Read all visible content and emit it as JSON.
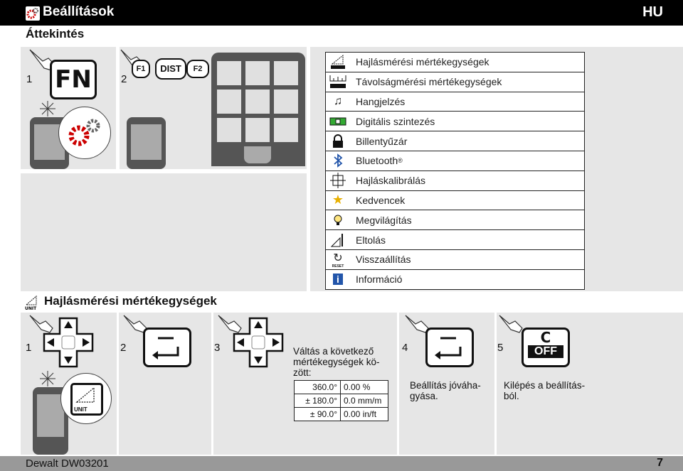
{
  "header": {
    "title": "Beállítások",
    "lang": "HU"
  },
  "subtitle": "Áttekintés",
  "overview": {
    "step1": "1",
    "step2": "2",
    "key_fn": "FN",
    "key_f1": "F1",
    "key_dist": "DIST",
    "key_f2": "F2"
  },
  "menu": [
    {
      "label": "Hajlásmérési mértékegységek",
      "icon": "tilt-unit-icon"
    },
    {
      "label": "Távolságmérési mértékegységek",
      "icon": "distance-unit-icon"
    },
    {
      "label": "Hangjelzés",
      "icon": "music-note-icon"
    },
    {
      "label": "Digitális szintezés",
      "icon": "level-icon"
    },
    {
      "label": "Billentyűzár",
      "icon": "lock-icon"
    },
    {
      "label": "Bluetooth",
      "icon": "bluetooth-icon",
      "suffix": "®"
    },
    {
      "label": "Hajláskalibrálás",
      "icon": "calibration-icon"
    },
    {
      "label": "Kedvencek",
      "icon": "star-icon"
    },
    {
      "label": "Megvilágítás",
      "icon": "bulb-icon"
    },
    {
      "label": "Eltolás",
      "icon": "offset-icon"
    },
    {
      "label": "Visszaállítás",
      "icon": "reset-icon",
      "sublabel": "RESET"
    },
    {
      "label": "Információ",
      "icon": "info-icon"
    }
  ],
  "unit_label": "UNIT",
  "section": {
    "title": "Hajlásmérési mértékegységek"
  },
  "steps": {
    "s1": "1",
    "s2": "2",
    "s3": "3",
    "s4": "4",
    "s5": "5",
    "step3_text": "Váltás a következő mértékegységek kö-zött:",
    "step4_text": "Beállítás jóváha-gyása.",
    "step5_text": "Kilépés a beállítás-ból.",
    "key_c": "C",
    "key_off": "OFF"
  },
  "units_table": [
    [
      "360.0°",
      "0.00 %"
    ],
    [
      "± 180.0°",
      "0.0 mm/m"
    ],
    [
      "± 90.0°",
      "0.00 in/ft"
    ]
  ],
  "footer": {
    "brand": "Dewalt DW03201",
    "page": "7"
  }
}
